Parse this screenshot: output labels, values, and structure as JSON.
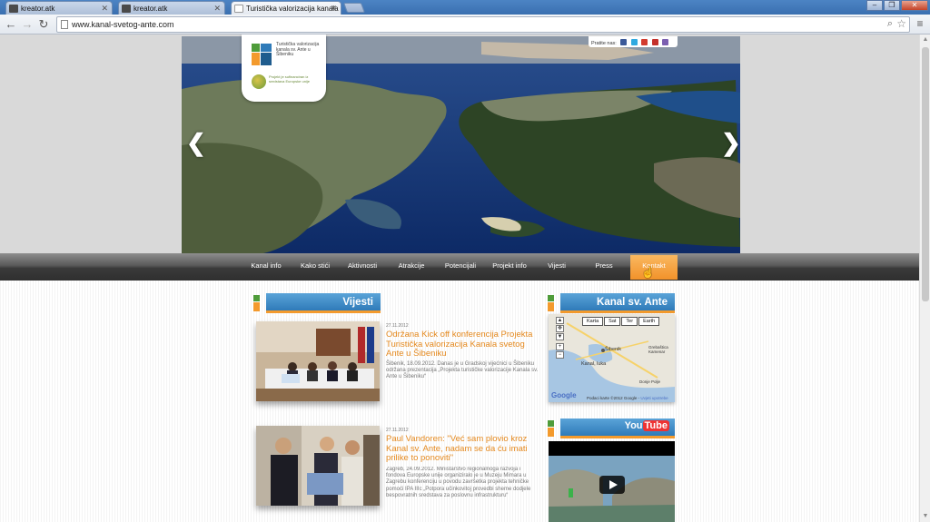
{
  "browser": {
    "tabs": [
      {
        "title": "kreator.atk"
      },
      {
        "title": "kreator.atk"
      },
      {
        "title": "Turistička valorizacija kanala"
      }
    ],
    "url": "www.kanal-svetog-ante.com"
  },
  "logo": {
    "text": "Turistička valorizacija kanala sv. Ante u Šibeniku",
    "partner_text": "Projekt je sufinanciran iz sredstava Europske unije"
  },
  "social": {
    "label": "Pratite nas:"
  },
  "nav": {
    "items": [
      {
        "label": "Kanal info"
      },
      {
        "label": "Kako stići"
      },
      {
        "label": "Aktivnosti"
      },
      {
        "label": "Atrakcije"
      },
      {
        "label": "Potencijali"
      },
      {
        "label": "Projekt info"
      },
      {
        "label": "Vijesti"
      },
      {
        "label": "Press"
      },
      {
        "label": "Kontakt"
      }
    ],
    "active": "Kontakt"
  },
  "vijesti": {
    "title": "Vijesti",
    "items": [
      {
        "date": "27.11.2012",
        "title": "Održana Kick off konferencija Projekta Turistička valorizacija Kanala svetog Ante u Šibeniku",
        "text": "Šibenik, 18.09.2012. Danas je u Gradskoj vijećnici u Šibeniku održana prezentacija „Projekta turističke valorizacije Kanala sv. Ante u Šibeniku“"
      },
      {
        "date": "27.11.2012",
        "title": "Paul Vandoren: \"Već sam plovio kroz Kanal sv. Ante, nadam se da ću imati prilike to ponoviti\"",
        "text": "Zagreb, 24.09.2012. Ministarstvo regionalnoga razvoja i fondova Europske unije organiziralo je u Muzeju Mimara u Zagrebu konferenciju u povodu završetka projekta tehničke pomoći IPA IIIc „Potpora učinkovitoj provedbi sheme dodjele bespovratnih sredstava za poslovnu infrastrukturu“"
      }
    ]
  },
  "kanal": {
    "title": "Kanal sv. Ante",
    "map_tabs": [
      "Karta",
      "Sat",
      "Ter",
      "Earth"
    ],
    "labels": [
      "Šibenik",
      "Kanal, luka",
      "Grebaštica Kamenar",
      "Donje Polje"
    ],
    "footer": "Podaci karte ©2012 Google -",
    "footer_link": "Uvjeti upotrebe",
    "google": "Google"
  },
  "youtube": {
    "you": "You",
    "tube": "Tube"
  }
}
